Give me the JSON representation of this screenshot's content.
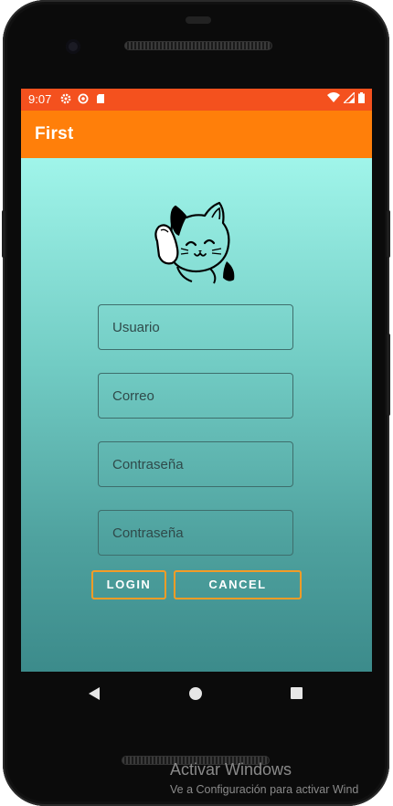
{
  "status_bar": {
    "time": "9:07",
    "background": "#f4511e",
    "left_icons": [
      "settings-icon",
      "data-saver-icon",
      "sd-card-icon"
    ],
    "right_icons": [
      "wifi-icon",
      "signal-icon",
      "battery-icon"
    ]
  },
  "app_bar": {
    "title": "First",
    "background": "#ff7f0a"
  },
  "form": {
    "username_placeholder": "Usuario",
    "email_placeholder": "Correo",
    "password_placeholder": "Contraseña",
    "confirm_password_placeholder": "Contraseña"
  },
  "buttons": {
    "login_label": "LOGIN",
    "cancel_label": "CANCEL",
    "border_color": "#f39c26"
  },
  "logo": "waving-cat-icon",
  "nav_bar": {
    "icons": [
      "back-icon",
      "home-icon",
      "recents-icon"
    ]
  },
  "watermark": {
    "title": "Activar Windows",
    "subtitle": "Ve a Configuración para activar Wind"
  }
}
